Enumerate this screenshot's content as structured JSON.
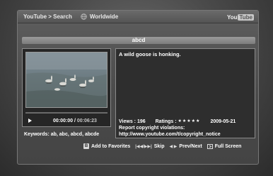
{
  "header": {
    "breadcrumb": "YouTube > Search",
    "region": "Worldwide",
    "logo_you": "You",
    "logo_tube": "Tube"
  },
  "query": "abcd",
  "player": {
    "current_time": "00:00:00",
    "separator": " / ",
    "total_time": "00:06:23",
    "progress": 0
  },
  "description": "A wild goose is honking.",
  "details": {
    "views_label": "Views : 196",
    "ratings_label": "Ratings :",
    "stars": "★★★★★",
    "rating_value": 5,
    "date": "2009-05-21",
    "copyright_label": "Report copyright violations:",
    "copyright_url": "http://www.youtube.com/t/copyright_notice"
  },
  "keywords": "Keywords: ab, abc, abcd, abcde",
  "hints": {
    "favorites_key": "B",
    "favorites": "Add to Favorites",
    "skip_key": "|◀◀/▶▶|",
    "skip": "Skip",
    "prevnext_key": "◀ ▶",
    "prevnext": "Prev/Next",
    "fullscreen": "Full Screen"
  },
  "colors": {
    "background": "#4a4a4a",
    "panel": "#2e2e2e",
    "query_bar": "#8a8a8a"
  }
}
